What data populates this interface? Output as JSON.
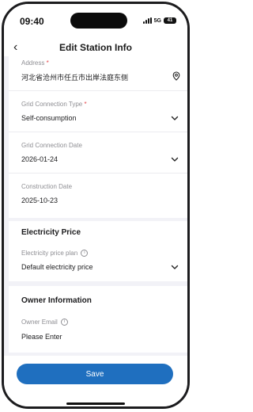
{
  "status_bar": {
    "time": "09:40",
    "network": "5G",
    "battery": "41"
  },
  "nav": {
    "back_icon": "chevron-left-icon",
    "title": "Edit Station Info"
  },
  "form": {
    "address": {
      "label": "Address",
      "required_mark": "*",
      "value": "河北省沧州市任丘市出岸法庭东侧",
      "icon": "location-pin-icon"
    },
    "grid_connection_type": {
      "label": "Grid Connection Type",
      "required_mark": "*",
      "value": "Self-consumption"
    },
    "grid_connection_date": {
      "label": "Grid Connection Date",
      "value": "2026-01-24"
    },
    "construction_date": {
      "label": "Construction Date",
      "value": "2025-10-23"
    }
  },
  "electricity_price": {
    "section_title": "Electricity Price",
    "plan_label": "Electricity price plan",
    "plan_value": "Default electricity price"
  },
  "owner_information": {
    "section_title": "Owner Information",
    "email_label": "Owner Email",
    "email_placeholder": "Please Enter"
  },
  "footer": {
    "save_label": "Save",
    "save_color": "#1f6fbf"
  }
}
